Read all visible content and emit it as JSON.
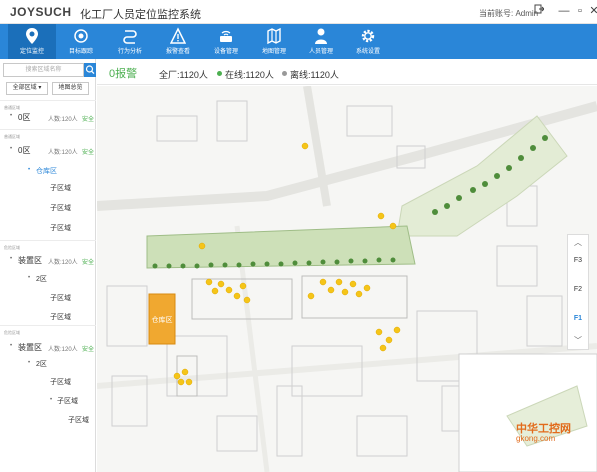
{
  "app": {
    "brand": "JOYSUCH",
    "title": "化工厂人员定位监控系统",
    "account": "当前账号: Admin"
  },
  "nav": {
    "items": [
      {
        "label": "定位监控",
        "icon": "location-pin-icon"
      },
      {
        "label": "目标跟踪",
        "icon": "target-icon"
      },
      {
        "label": "行为分析",
        "icon": "route-icon"
      },
      {
        "label": "报警查看",
        "icon": "warning-icon"
      },
      {
        "label": "设备管理",
        "icon": "router-icon"
      },
      {
        "label": "地图管理",
        "icon": "map-icon"
      },
      {
        "label": "人员管理",
        "icon": "person-icon"
      },
      {
        "label": "系统设置",
        "icon": "gear-icon"
      }
    ]
  },
  "sidebar": {
    "search_placeholder": "搜索区域名称",
    "all_regions": "全部区域",
    "map_overview": "地图总览",
    "groups": [
      {
        "title": "普通区域",
        "name": "0区",
        "count": "人数:120人",
        "status": "安全"
      },
      {
        "title": "普通区域",
        "name": "0区",
        "count": "人数:120人",
        "status": "安全",
        "children": [
          "仓库区",
          "子区域",
          "子区域",
          "子区域"
        ]
      },
      {
        "title": "危险区域",
        "name": "装置区",
        "count": "人数:120人",
        "status": "安全",
        "children": [
          "2区",
          "子区域",
          "子区域"
        ]
      },
      {
        "title": "危险区域",
        "name": "装置区",
        "count": "人数:120人",
        "status": "安全",
        "children": [
          "2区",
          "子区域",
          "子区域",
          "子区域"
        ]
      }
    ]
  },
  "stats": {
    "alarm": "0报警",
    "total": "全厂:1120人",
    "online": "在线:1120人",
    "offline": "离线:1120人"
  },
  "map": {
    "warehouse_label": "仓库区",
    "floors": [
      "F3",
      "F2",
      "F1"
    ],
    "active_floor": "F1"
  },
  "watermark": {
    "line1": "中华工控网",
    "line2": "gkong.com"
  },
  "colors": {
    "nav_bg": "#2a86d8",
    "nav_active": "#1b6fba",
    "safe": "#4caf50",
    "warehouse": "#f0a830",
    "marker": "#f5c518"
  }
}
